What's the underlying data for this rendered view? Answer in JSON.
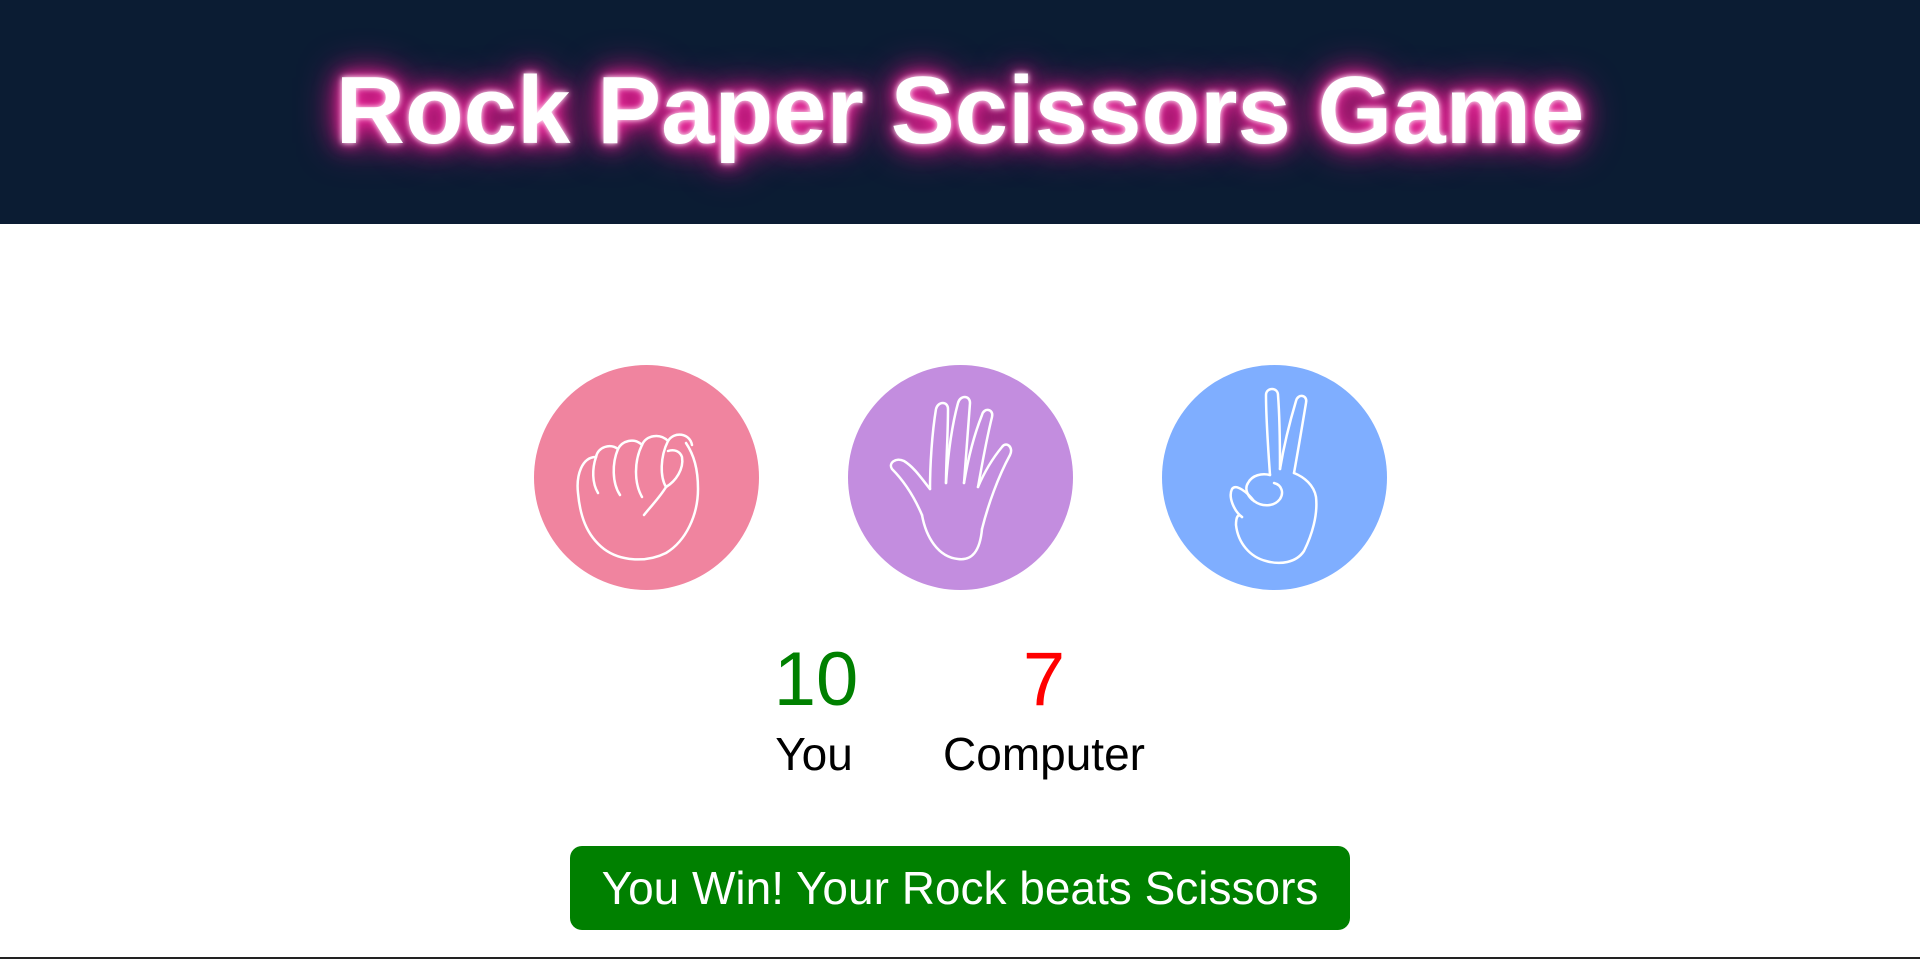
{
  "header": {
    "title": "Rock Paper Scissors Game",
    "background_color": "#0b1c33",
    "glow_color": "#ff1493"
  },
  "choices": [
    {
      "name": "rock",
      "icon": "fist-hand-icon",
      "color": "#f0849f"
    },
    {
      "name": "paper",
      "icon": "open-hand-icon",
      "color": "#c38ddf"
    },
    {
      "name": "scissors",
      "icon": "peace-sign-hand-icon",
      "color": "#7faeff"
    }
  ],
  "scoreboard": {
    "user_score": "10",
    "user_label": "You",
    "user_color": "#008000",
    "computer_score": "7",
    "computer_label": "Computer",
    "computer_color": "#ff0000"
  },
  "result": {
    "message": "You Win! Your Rock beats Scissors",
    "background_color": "#008000"
  }
}
